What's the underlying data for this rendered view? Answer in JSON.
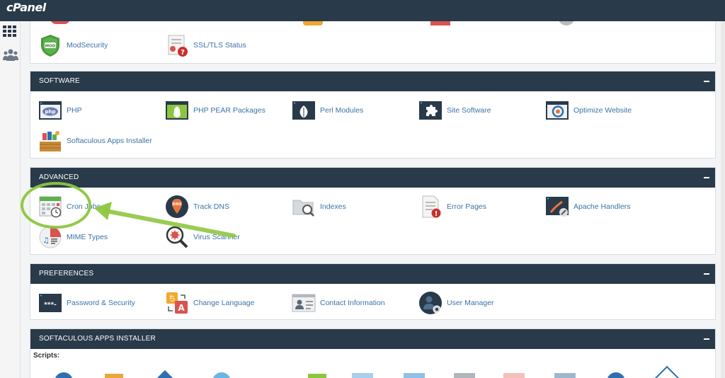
{
  "header": {
    "logo_text": "cPanel"
  },
  "sidebar": {
    "items": [
      {
        "icon": "grid-icon"
      },
      {
        "icon": "users-icon"
      }
    ]
  },
  "security": {
    "items": [
      {
        "label": "ModSecurity",
        "icon": "modsecurity-shield-icon",
        "badge": "MOD"
      },
      {
        "label": "SSL/TLS Status",
        "icon": "ssl-certificate-icon"
      }
    ]
  },
  "software": {
    "title": "SOFTWARE",
    "items": [
      {
        "label": "PHP",
        "icon": "php-icon",
        "badge": "php"
      },
      {
        "label": "PHP PEAR Packages",
        "icon": "pear-icon"
      },
      {
        "label": "Perl Modules",
        "icon": "perl-onion-icon"
      },
      {
        "label": "Site Software",
        "icon": "puzzle-icon"
      },
      {
        "label": "Optimize Website",
        "icon": "optimize-target-icon"
      },
      {
        "label": "Softaculous Apps Installer",
        "icon": "softaculous-icon"
      }
    ]
  },
  "advanced": {
    "title": "ADVANCED",
    "items": [
      {
        "label": "Cron Jobs",
        "icon": "calendar-clock-icon"
      },
      {
        "label": "Track DNS",
        "icon": "dns-pin-icon",
        "badge": "DNS"
      },
      {
        "label": "Indexes",
        "icon": "folder-search-icon"
      },
      {
        "label": "Error Pages",
        "icon": "error-page-icon"
      },
      {
        "label": "Apache Handlers",
        "icon": "apache-handlers-icon"
      },
      {
        "label": "MIME Types",
        "icon": "mime-music-icon"
      },
      {
        "label": "Virus Scanner",
        "icon": "virus-scanner-icon"
      }
    ]
  },
  "preferences": {
    "title": "PREFERENCES",
    "items": [
      {
        "label": "Password & Security",
        "icon": "password-icon",
        "badge": "***-"
      },
      {
        "label": "Change Language",
        "icon": "language-icon"
      },
      {
        "label": "Contact Information",
        "icon": "contact-card-icon"
      },
      {
        "label": "User Manager",
        "icon": "user-manager-icon"
      }
    ]
  },
  "softaculous": {
    "title": "SOFTACULOUS APPS INSTALLER",
    "scripts_label": "Scripts:"
  },
  "colors": {
    "header_bg": "#293a4a",
    "link": "#3a73a8",
    "annotation": "#8dc63f"
  }
}
